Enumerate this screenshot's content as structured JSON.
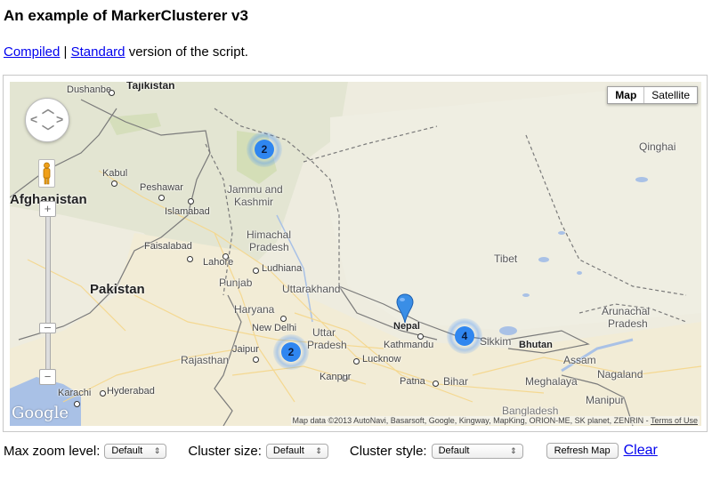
{
  "page": {
    "title": "An example of MarkerClusterer v3",
    "links": {
      "compiled": "Compiled",
      "separator": "|",
      "standard": "Standard",
      "suffix": "version of the script."
    }
  },
  "map": {
    "map_type": {
      "map": "Map",
      "satellite": "Satellite",
      "selected": "Map"
    },
    "controls": {
      "pan_icon": "pan-control-icon",
      "pegman_icon": "street-view-pegman-icon",
      "zoom_in": "+",
      "zoom_out": "−"
    },
    "logo": "Google",
    "attribution": "Map data ©2013 AutoNavi, Basarsoft, Google, Kingway, MapKing, ORION-ME, SK planet, ZENRIN -",
    "terms": "Terms of Use",
    "clusters": [
      {
        "count": "2"
      },
      {
        "count": "2"
      },
      {
        "count": "4"
      }
    ],
    "marker": {
      "icon": "map-pin-icon",
      "color": "#3a8ee6"
    },
    "labels": {
      "tajikistan": "Tajikistan",
      "dushanbe": "Dushanbe",
      "afghanistan": "Afghanistan",
      "kabul": "Kabul",
      "peshawar": "Peshawar",
      "islamabad": "Islamabad",
      "jammu": "Jammu and",
      "kashmir": "Kashmir",
      "faisalabad": "Faisalabad",
      "lahore": "Lahore",
      "himachal": "Himachal",
      "pradesh1": "Pradesh",
      "ludhiana": "Ludhiana",
      "pakistan": "Pakistan",
      "punjab": "Punjab",
      "uttarakhand": "Uttarakhand",
      "haryana": "Haryana",
      "newdelhi": "New Delhi",
      "uttar": "Uttar",
      "pradesh2": "Pradesh",
      "jaipur": "Jaipur",
      "rajasthan": "Rajasthan",
      "lucknow": "Lucknow",
      "kanpur": "Kanpur",
      "karachi": "Karachi",
      "hyderabad": "Hyderabad",
      "nepal": "Nepal",
      "kathmandu": "Kathmandu",
      "sikkim": "Sikkim",
      "bhutan": "Bhutan",
      "patna": "Patna",
      "bihar": "Bihar",
      "tibet": "Tibet",
      "qinghai": "Qinghai",
      "arunachal": "Arunachal",
      "pradesh3": "Pradesh",
      "assam": "Assam",
      "meghalaya": "Meghalaya",
      "nagaland": "Nagaland",
      "manipur": "Manipur",
      "bangladesh": "Bangladesh"
    }
  },
  "controls": {
    "max_zoom": {
      "label": "Max zoom level:",
      "value": "Default"
    },
    "cluster_size": {
      "label": "Cluster size:",
      "value": "Default"
    },
    "cluster_style": {
      "label": "Cluster style:",
      "value": "Default"
    },
    "refresh": "Refresh Map",
    "clear": "Clear"
  }
}
